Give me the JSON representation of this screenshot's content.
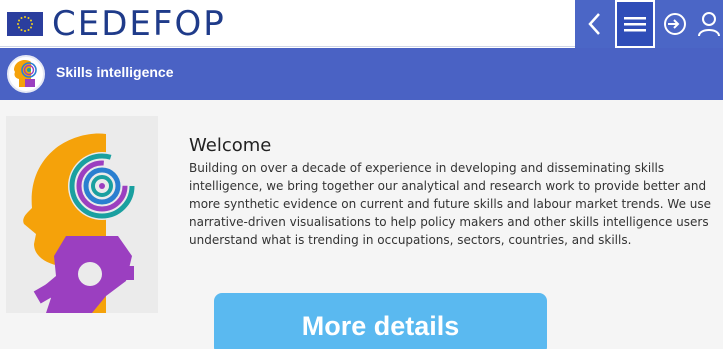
{
  "header": {
    "logo_text": "CEDEFOP",
    "icons": {
      "eu_flag": "eu-flag-icon",
      "back": "chevron-left-icon",
      "menu": "hamburger-menu-icon",
      "login": "login-icon",
      "user": "user-icon"
    }
  },
  "section": {
    "title": "Skills intelligence",
    "icon": "skills-head-icon"
  },
  "main": {
    "welcome_title": "Welcome",
    "welcome_text": "Building on over a decade of experience in developing and disseminating skills intelligence, we bring together our analytical and research work to provide better and more synthetic evidence on current and future skills and labour market trends. We use narrative-driven visualisations to help policy makers and other skills intelligence users understand what is trending in occupations, sectors, countries, and skills.",
    "more_button_label": "More details"
  },
  "colors": {
    "brand_blue": "#4a62c4",
    "logo_blue": "#1f3b8a",
    "button_blue": "#5ab9f0",
    "head_orange": "#f5a20a",
    "gear_purple": "#9b3fc0"
  }
}
